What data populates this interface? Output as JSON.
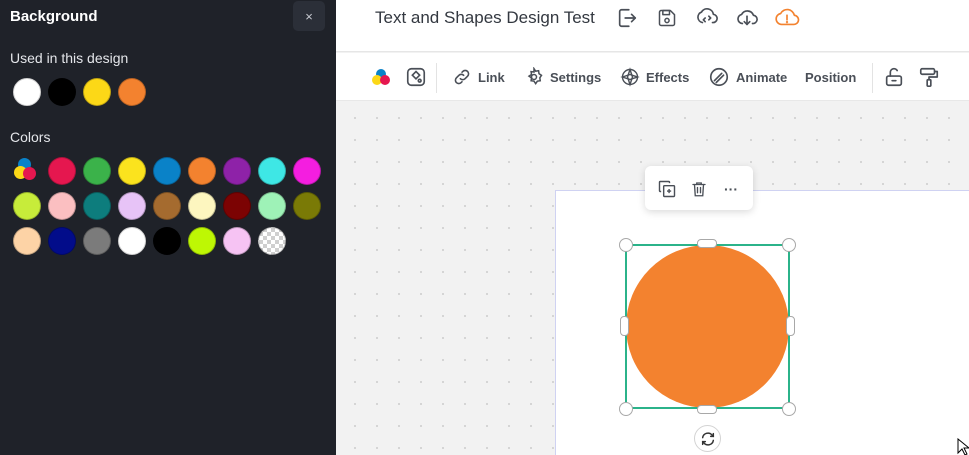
{
  "panel": {
    "title": "Background",
    "close_label": "×",
    "used_label": "Used in this design",
    "colors_label": "Colors",
    "used_colors": [
      "#ffffff",
      "#000000",
      "#fcd817",
      "#f3822f"
    ],
    "colors": [
      "picker",
      "#e5174f",
      "#3bb24a",
      "#fbe31e",
      "#0a82c8",
      "#f3822f",
      "#8e22a8",
      "#3ee7e5",
      "#f41ee0",
      "#c7ec3a",
      "#fbbfc1",
      "#0d7d7d",
      "#e7c3f7",
      "#a56b2f",
      "#fdf6bf",
      "#7c0303",
      "#9ef2b7",
      "#7a7a06",
      "#fdd3a6",
      "#020c8a",
      "#7b7b7b",
      "#ffffff",
      "#000000",
      "#bef704",
      "#f6c3f3",
      "transparent"
    ]
  },
  "header": {
    "title": "Text and Shapes Design Test",
    "icons": [
      "export-icon",
      "save-icon",
      "sync-icon",
      "download-icon",
      "cloud-warning-icon"
    ]
  },
  "toolbar": {
    "link_label": "Link",
    "settings_label": "Settings",
    "effects_label": "Effects",
    "animate_label": "Animate",
    "position_label": "Position"
  },
  "canvas": {
    "shape_type": "circle",
    "shape_color": "#f3822f",
    "selection_color": "#2bb38a"
  }
}
